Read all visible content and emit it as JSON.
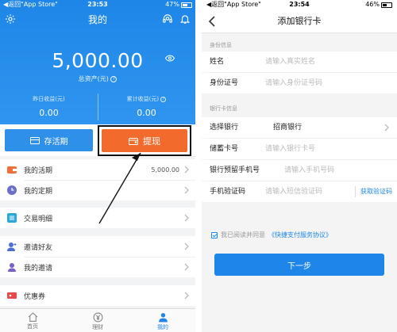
{
  "left": {
    "status": {
      "back": "◀返回\"App Store\"",
      "time": "23:53",
      "battery": "47%"
    },
    "header": {
      "title": "我的"
    },
    "summary": {
      "amount": "5,000.00",
      "total_label": "总资产(元)",
      "yesterday_label": "昨日收益(元)",
      "yesterday_value": "0.00",
      "cumulative_label": "累计收益(元)",
      "cumulative_value": "0.00"
    },
    "buttons": {
      "deposit": "存活期",
      "withdraw": "提现"
    },
    "menu": [
      {
        "label": "我的活期",
        "value": "5,000.00",
        "icon": "wallet-icon",
        "color": "#f0703a"
      },
      {
        "label": "我的定期",
        "value": "",
        "icon": "clock-icon",
        "color": "#6b6fc7"
      },
      {
        "label": "交易明细",
        "value": "",
        "icon": "list-icon",
        "color": "#2aa8d9"
      },
      {
        "label": "邀请好友",
        "value": "",
        "icon": "person-add-icon",
        "color": "#4b6fd6"
      },
      {
        "label": "我的邀请",
        "value": "",
        "icon": "person-icon",
        "color": "#7a5fc9"
      },
      {
        "label": "优惠券",
        "value": "",
        "icon": "coupon-icon",
        "color": "#e84a4a"
      }
    ],
    "tabs": [
      {
        "label": "首页",
        "icon": "home-icon"
      },
      {
        "label": "理财",
        "icon": "yen-icon"
      },
      {
        "label": "我的",
        "icon": "user-icon"
      }
    ]
  },
  "right": {
    "status": {
      "back": "◀返回\"App Store\"",
      "time": "23:54",
      "battery": "46%"
    },
    "header": {
      "title": "添加银行卡"
    },
    "identity_section": "身份信息",
    "name_label": "姓名",
    "name_placeholder": "请输入真实姓名",
    "id_label": "身份证号",
    "id_placeholder": "请输入身份证号码",
    "card_section": "银行卡信息",
    "bank_label": "选择银行",
    "bank_value": "招商银行",
    "card_label": "储蓄卡号",
    "card_placeholder": "请输入银行卡号",
    "phone_label": "银行预留手机号",
    "phone_placeholder": "请输入手机号码",
    "code_label": "手机验证码",
    "code_placeholder": "请输入短信验证码",
    "get_code": "获取验证码",
    "agree_prefix": "我已阅读并同意",
    "agree_link": "《快捷支付服务协议》",
    "next_button": "下一步"
  }
}
